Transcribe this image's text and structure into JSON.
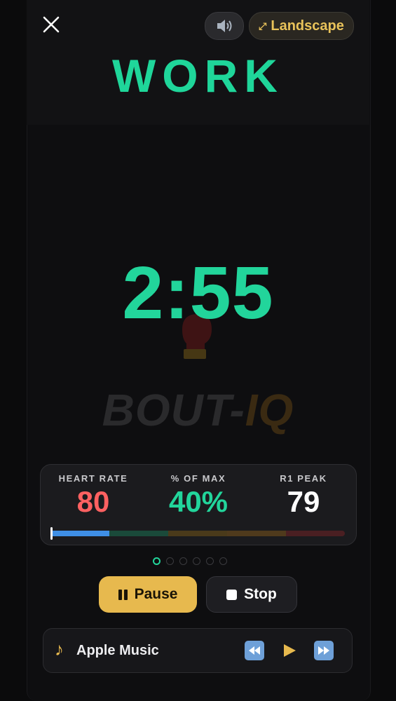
{
  "header": {
    "landscape_label": "Landscape",
    "landscape_arrow": "⤢",
    "sound_icon": "speaker-icon",
    "close_icon": "close-icon"
  },
  "phase": {
    "title": "WORK",
    "color": "#1fd69a"
  },
  "timer": {
    "value": "2:55"
  },
  "brand": {
    "part1": "BOUT-",
    "part2": "IQ"
  },
  "metrics": {
    "heart_rate": {
      "label": "HEART RATE",
      "value": "80",
      "color": "#ff6161"
    },
    "percent_max": {
      "label": "% OF MAX",
      "value": "40%",
      "color": "#22d59b"
    },
    "peak": {
      "label": "R1 PEAK",
      "value": "79",
      "color": "#ffffff"
    },
    "zone_colors": [
      "#3f8fe6",
      "#1a4a3a",
      "#4a3a1a",
      "#4f3a1c",
      "#4a1f22"
    ]
  },
  "pager": {
    "count": 6,
    "active_index": 0
  },
  "controls": {
    "pause_label": "Pause",
    "stop_label": "Stop",
    "pause_color": "#e7b94e"
  },
  "music": {
    "source": "Apple Music",
    "note_icon": "music-note-icon",
    "prev_icon": "skip-back-icon",
    "play_icon": "play-icon",
    "next_icon": "skip-forward-icon"
  }
}
